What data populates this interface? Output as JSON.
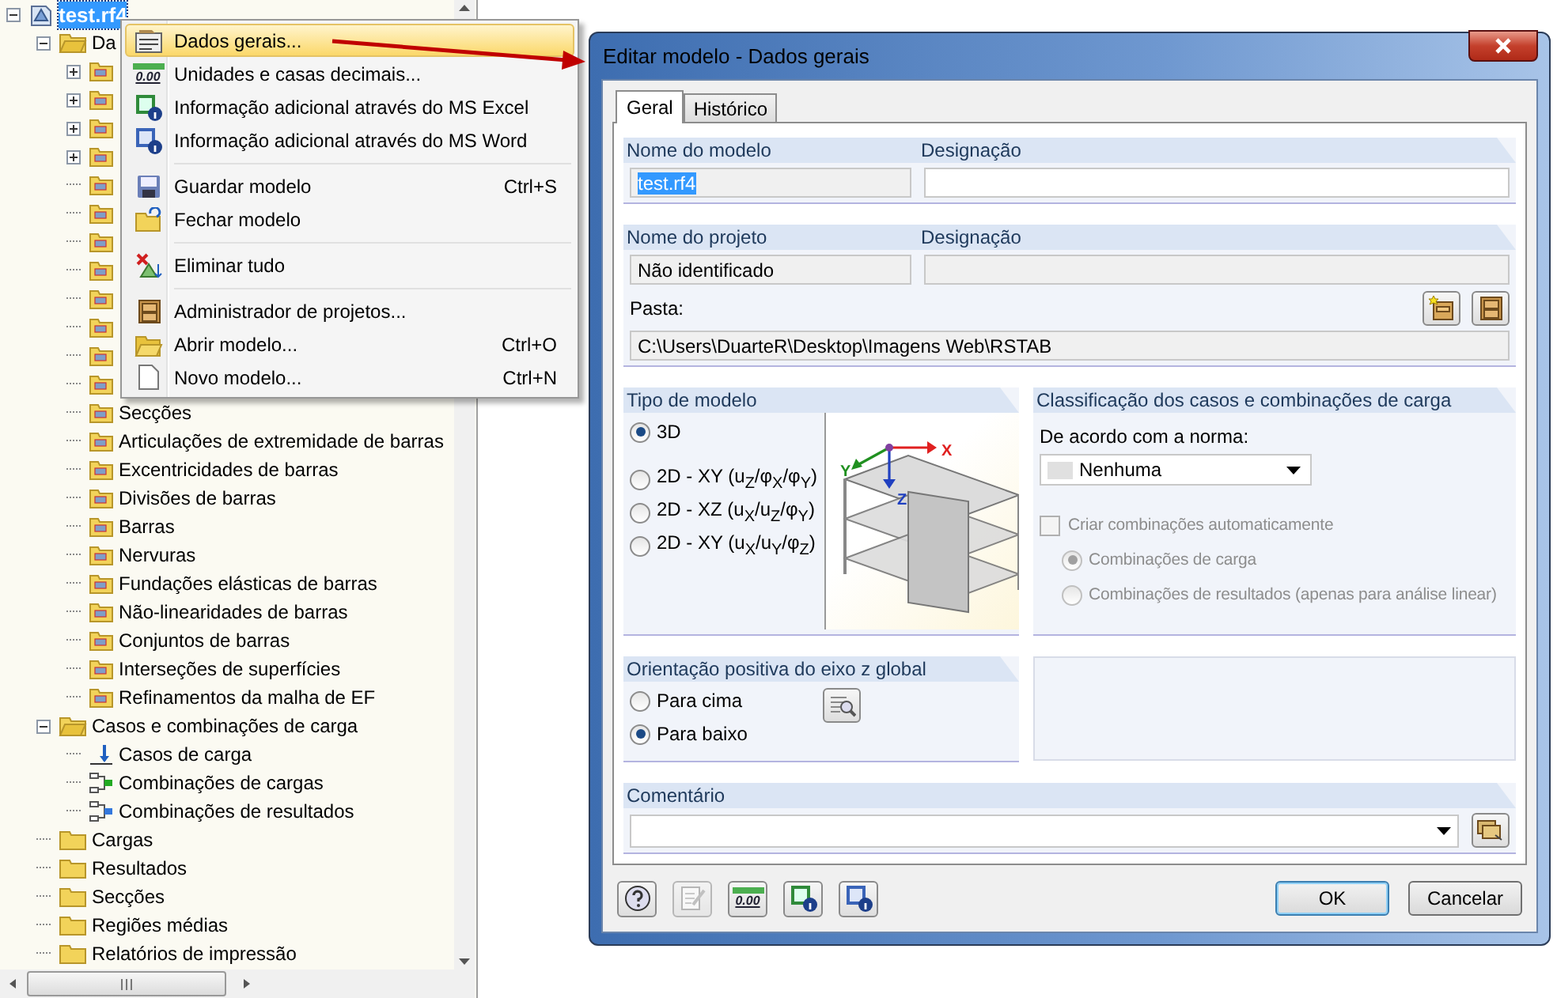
{
  "tree": [
    {
      "label": "test.rf4",
      "kind": "model",
      "selected": true,
      "expanded": true,
      "children": [
        {
          "label": "Da",
          "kind": "folder",
          "expanded": true,
          "children": [
            {
              "kind": "folder",
              "expanded": false
            },
            {
              "kind": "folder",
              "expanded": false
            },
            {
              "kind": "folder",
              "expanded": false
            },
            {
              "kind": "folder",
              "expanded": false
            },
            {
              "kind": "folder"
            },
            {
              "kind": "folder"
            },
            {
              "kind": "folder"
            },
            {
              "kind": "folder"
            },
            {
              "kind": "folder"
            },
            {
              "kind": "folder"
            },
            {
              "kind": "folder"
            },
            {
              "kind": "folder"
            },
            {
              "label": "Secções",
              "kind": "folder"
            },
            {
              "label": "Articulações de extremidade de barras",
              "kind": "folder"
            },
            {
              "label": "Excentricidades de barras",
              "kind": "folder"
            },
            {
              "label": "Divisões de barras",
              "kind": "folder"
            },
            {
              "label": "Barras",
              "kind": "folder"
            },
            {
              "label": "Nervuras",
              "kind": "folder"
            },
            {
              "label": "Fundações elásticas de barras",
              "kind": "folder"
            },
            {
              "label": "Não-linearidades de barras",
              "kind": "folder"
            },
            {
              "label": "Conjuntos de barras",
              "kind": "folder"
            },
            {
              "label": "Interseções de superfícies",
              "kind": "folder"
            },
            {
              "label": "Refinamentos da malha de EF",
              "kind": "folder"
            }
          ]
        },
        {
          "label": "Casos e combinações de carga",
          "kind": "folder",
          "expanded": true,
          "children": [
            {
              "label": "Casos de carga",
              "kind": "load"
            },
            {
              "label": "Combinações de cargas",
              "kind": "combo",
              "color": "#22aa22"
            },
            {
              "label": "Combinações de resultados",
              "kind": "combo",
              "color": "#3377dd"
            }
          ]
        },
        {
          "label": "Cargas",
          "kind": "folder"
        },
        {
          "label": "Resultados",
          "kind": "folder"
        },
        {
          "label": "Secções",
          "kind": "folder"
        },
        {
          "label": "Regiões médias",
          "kind": "folder"
        },
        {
          "label": "Relatórios de impressão",
          "kind": "folder"
        }
      ]
    }
  ],
  "menu": [
    {
      "kind": "item",
      "label": "Dados gerais...",
      "selected": true
    },
    {
      "kind": "item",
      "label": "Unidades e casas decimais...",
      "badge": "0.00",
      "selected": false
    },
    {
      "kind": "item",
      "label": "Informação adicional através do MS Excel",
      "selected": false
    },
    {
      "kind": "item",
      "label": "Informação adicional através do MS Word",
      "selected": false
    },
    {
      "kind": "separator"
    },
    {
      "kind": "item",
      "label": "Guardar modelo",
      "shortcut": "Ctrl+S",
      "selected": false
    },
    {
      "kind": "item",
      "label": "Fechar modelo",
      "selected": false
    },
    {
      "kind": "separator"
    },
    {
      "kind": "item",
      "label": "Eliminar tudo",
      "selected": false
    },
    {
      "kind": "separator"
    },
    {
      "kind": "item",
      "label": "Administrador de projetos...",
      "selected": false
    },
    {
      "kind": "item",
      "label": "Abrir modelo...",
      "shortcut": "Ctrl+O",
      "selected": false
    },
    {
      "kind": "item",
      "label": "Novo modelo...",
      "shortcut": "Ctrl+N",
      "selected": false
    }
  ],
  "dialog": {
    "title": "Editar modelo - Dados gerais",
    "tabs": [
      {
        "label": "Geral",
        "selected": true
      },
      {
        "label": "Histórico",
        "selected": false
      }
    ],
    "model": {
      "name_label": "Nome do modelo",
      "name_value": "test.rf4",
      "designation_label": "Designação"
    },
    "project": {
      "name_label": "Nome do projeto",
      "name_value": "Não identificado",
      "designation_label": "Designação",
      "folder_label": "Pasta:",
      "folder_value": "C:\\Users\\DuarteR\\Desktop\\Imagens Web\\RSTAB"
    },
    "model_type": {
      "title": "Tipo de modelo",
      "preview_axes": [
        "X",
        "Y",
        "Z"
      ],
      "options": [
        {
          "label": "3D",
          "selected": true
        },
        {
          "label": "2D - XY (u$_{Z}$/φ$_{X}$/φ$_{Y}$)",
          "selected": false
        },
        {
          "label": "2D - XZ (u$_{X}$/u$_{Z}$/φ$_{Y}$)",
          "selected": false
        },
        {
          "label": "2D - XY (u$_{X}$/u$_{Y}$/φ$_{Z}$)",
          "selected": false
        }
      ]
    },
    "classification": {
      "title": "Classificação dos casos e combinações de carga",
      "standard_label": "De acordo com a norma:",
      "standard_value": "Nenhuma",
      "auto_label": "Criar combinações automaticamente",
      "auto_checked": false,
      "disabled": true,
      "options": [
        {
          "label": "Combinações de carga",
          "selected": true
        },
        {
          "label": "Combinações de resultados (apenas para análise linear)",
          "selected": false
        }
      ]
    },
    "orientation": {
      "title": "Orientação positiva do eixo z global",
      "options": [
        {
          "label": "Para cima",
          "selected": false
        },
        {
          "label": "Para baixo",
          "selected": true
        }
      ]
    },
    "comment": {
      "title": "Comentário"
    },
    "tools": [
      {
        "kind": "help"
      },
      {
        "kind": "edit",
        "disabled": true
      },
      {
        "kind": "units",
        "badge": "0.00"
      },
      {
        "kind": "excel"
      },
      {
        "kind": "word"
      }
    ],
    "buttons": [
      {
        "label": "OK",
        "default": true
      },
      {
        "label": "Cancelar",
        "default": false
      }
    ]
  }
}
